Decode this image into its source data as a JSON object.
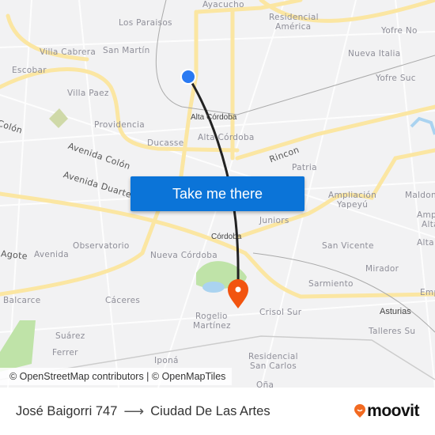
{
  "map": {
    "labels": [
      "Ayacucho",
      "Los Paraisos",
      "Residencial",
      "América",
      "Yofre No",
      "Villa Cabrera",
      "San Martín",
      "Escobar",
      "Nueva Italia",
      "Yofre Suc",
      "Villa Paez",
      "Alta Córdoba",
      "Providencia",
      "Colón",
      "Ducasse",
      "Alta Córdoba",
      "Avenida Colón",
      "Rincon",
      "Patria",
      "Avenida Duarte Q",
      "Ampliación",
      "Yapeyú",
      "Maldon",
      "Juniors",
      "Córdoba",
      "Observatorio",
      "Agote",
      "Avenida",
      "Nueva Córdoba",
      "San Vicente",
      "Amp",
      "Alta",
      "Alta",
      "Mirador",
      "Sarmiento",
      "Emp",
      "Balcarce",
      "Cáceres",
      "Crisol Sur",
      "Asturias",
      "Rogelio",
      "Martínez",
      "Talleres Su",
      "Suárez",
      "Ferrer",
      "Iponá",
      "Residencial",
      "San Carlos",
      "Oña"
    ],
    "origin_marker_color": "#2a7af2",
    "destination_marker_color": "#f2540f",
    "route_color": "#222222",
    "attribution": "© OpenStreetMap contributors | © OpenMapTiles"
  },
  "cta": {
    "label": "Take me there",
    "color": "#0b74d8"
  },
  "trip": {
    "origin": "José Baigorri 747",
    "arrow": "⟶",
    "destination": "Ciudad De Las Artes"
  },
  "brand": {
    "name": "moovit",
    "color": "#f26a21"
  }
}
